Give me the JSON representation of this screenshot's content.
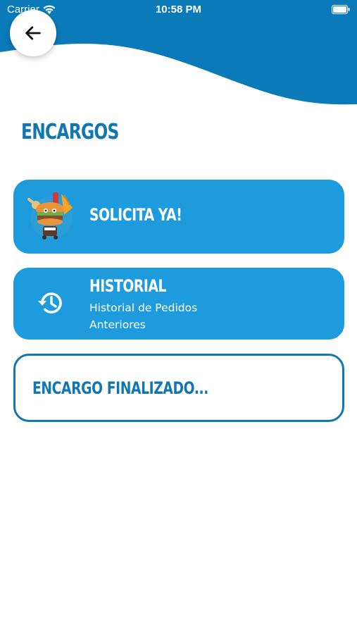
{
  "status": {
    "carrier": "Carrier",
    "time": "10:58 PM"
  },
  "header": {
    "back_icon": "arrow-left-icon"
  },
  "page": {
    "title": "ENCARGOS"
  },
  "cards": [
    {
      "title": "SOLICITA YA!",
      "icon": "food-mascot-illustration"
    },
    {
      "title": "HISTORIAL",
      "subtitle_line1": "Historial de Pedidos",
      "subtitle_line2": "Anteriores",
      "icon": "history-icon"
    },
    {
      "title": "ENCARGO FINALIZADO..."
    }
  ],
  "colors": {
    "primary": "#1e9bdc",
    "dark_blue": "#1177b3",
    "wave": "#0a7ab8"
  }
}
